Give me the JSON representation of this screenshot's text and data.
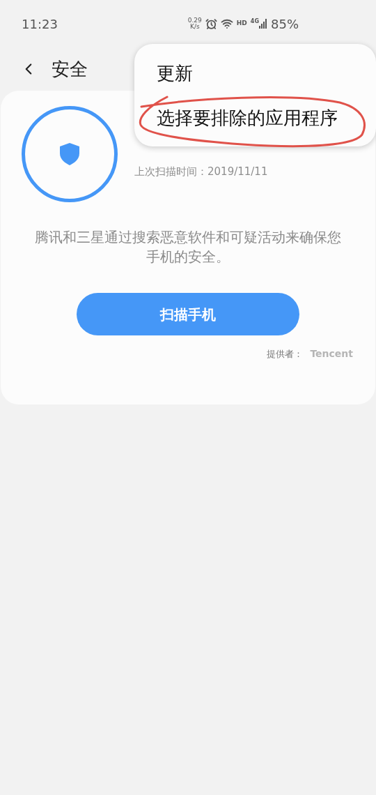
{
  "status_bar": {
    "time": "11:23",
    "speed_value": "0.29",
    "speed_unit": "K/s",
    "hd": "HD",
    "network": "4G",
    "battery": "85%"
  },
  "header": {
    "title": "安全"
  },
  "card": {
    "last_scan": "上次扫描时间：2019/11/11",
    "description": "腾讯和三星通过搜索恶意软件和可疑活动来确保您手机的安全。",
    "scan_button": "扫描手机",
    "provider_label": "提供者：",
    "provider": "Tencent"
  },
  "menu": {
    "items": [
      {
        "label": "更新"
      },
      {
        "label": "选择要排除的应用程序"
      }
    ]
  }
}
